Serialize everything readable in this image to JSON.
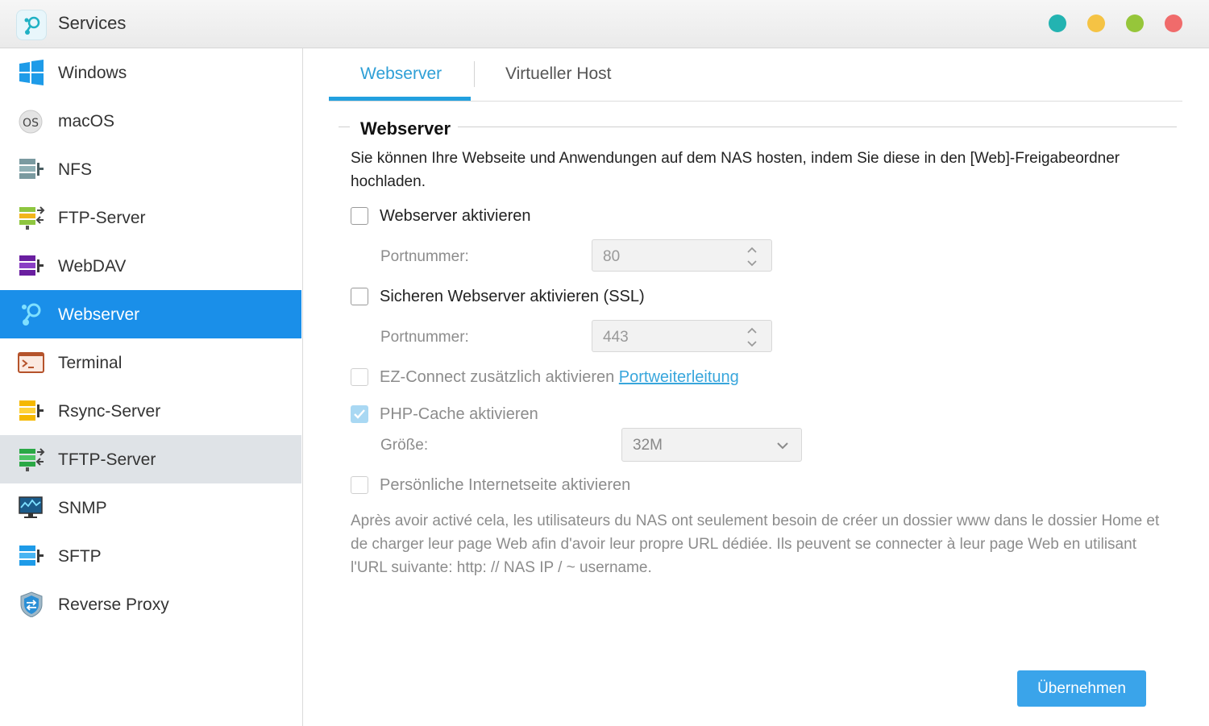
{
  "window": {
    "title": "Services",
    "app_icon": "services-icon",
    "controls": [
      {
        "name": "teal-window-button",
        "color": "#23b3b1"
      },
      {
        "name": "minimize-window-button",
        "color": "#f5c344"
      },
      {
        "name": "maximize-window-button",
        "color": "#96c63a"
      },
      {
        "name": "close-window-button",
        "color": "#f06b6b"
      }
    ]
  },
  "sidebar": {
    "items": [
      {
        "label": "Windows",
        "icon": "windows-icon",
        "state": "normal"
      },
      {
        "label": "macOS",
        "icon": "macos-icon",
        "state": "normal"
      },
      {
        "label": "NFS",
        "icon": "nfs-icon",
        "state": "normal"
      },
      {
        "label": "FTP-Server",
        "icon": "ftp-server-icon",
        "state": "normal"
      },
      {
        "label": "WebDAV",
        "icon": "webdav-icon",
        "state": "normal"
      },
      {
        "label": "Webserver",
        "icon": "webserver-icon",
        "state": "active"
      },
      {
        "label": "Terminal",
        "icon": "terminal-icon",
        "state": "normal"
      },
      {
        "label": "Rsync-Server",
        "icon": "rsync-server-icon",
        "state": "normal"
      },
      {
        "label": "TFTP-Server",
        "icon": "tftp-server-icon",
        "state": "hover"
      },
      {
        "label": "SNMP",
        "icon": "snmp-icon",
        "state": "normal"
      },
      {
        "label": "SFTP",
        "icon": "sftp-icon",
        "state": "normal"
      },
      {
        "label": "Reverse Proxy",
        "icon": "reverse-proxy-icon",
        "state": "normal"
      }
    ]
  },
  "tabs": {
    "webserver": "Webserver",
    "virtual_host": "Virtueller Host",
    "active": "Webserver"
  },
  "section": {
    "title": "Webserver",
    "description": "Sie können Ihre Webseite und Anwendungen auf dem NAS hosten, indem Sie diese in den [Web]-Freigabeordner hochladen."
  },
  "options": {
    "enable_webserver": {
      "label": "Webserver aktivieren",
      "checked": false
    },
    "port_label": "Portnummer:",
    "port_value": "80",
    "enable_ssl": {
      "label": "Sicheren Webserver aktivieren (SSL)",
      "checked": false
    },
    "ssl_port_label": "Portnummer:",
    "ssl_port_value": "443",
    "ez_connect": {
      "label": "EZ-Connect zusätzlich aktivieren",
      "link": "Portweiterleitung",
      "checked": false
    },
    "php_cache": {
      "label": "PHP-Cache aktivieren",
      "checked": true
    },
    "size_label": "Größe:",
    "size_value": "32M",
    "personal_site": {
      "label": "Persönliche Internetseite aktivieren",
      "checked": false
    },
    "personal_note": "Après avoir activé cela, les utilisateurs du NAS ont seulement besoin de créer un dossier www dans le dossier Home et de charger leur page Web afin d'avoir leur propre URL dédiée. Ils peuvent se connecter à leur page Web en utilisant l'URL suivante: http: // NAS IP / ~ username."
  },
  "buttons": {
    "apply": "Übernehmen"
  },
  "colors": {
    "accent": "#1a8fe9",
    "tab_active": "#2e9fd6",
    "apply_button": "#3aa4ea"
  }
}
